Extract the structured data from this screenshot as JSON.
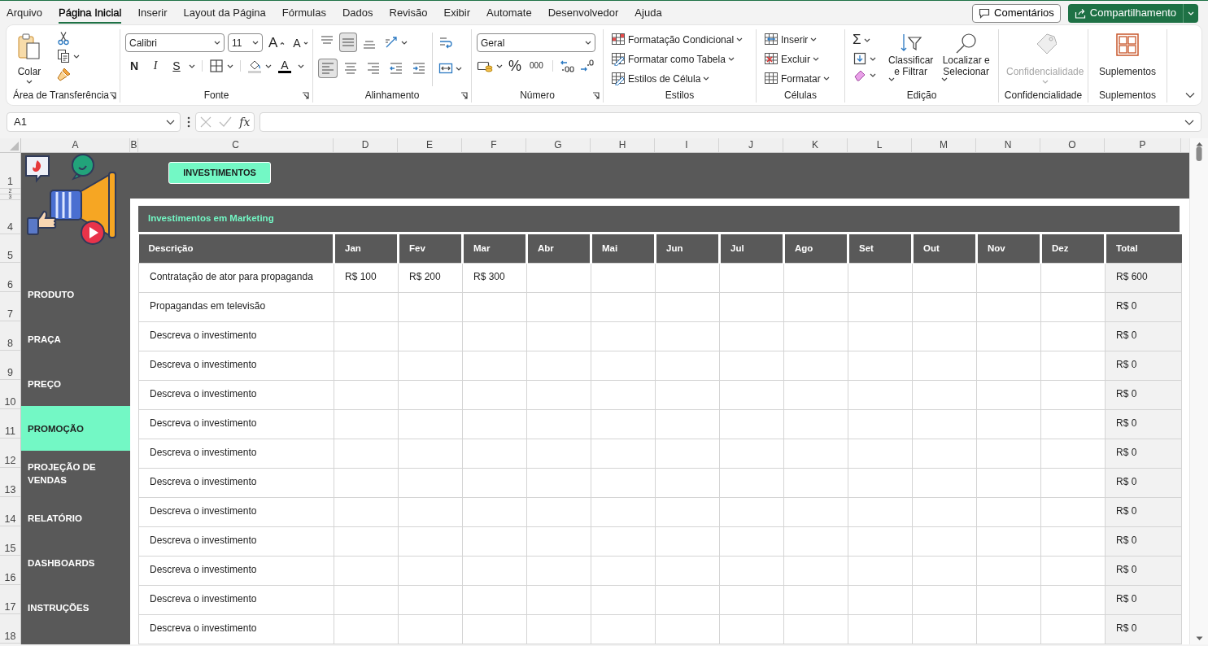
{
  "menu_tabs": [
    {
      "label": "Arquivo",
      "selected": false
    },
    {
      "label": "Página Inicial",
      "selected": true
    },
    {
      "label": "Inserir",
      "selected": false
    },
    {
      "label": "Layout da Página",
      "selected": false
    },
    {
      "label": "Fórmulas",
      "selected": false
    },
    {
      "label": "Dados",
      "selected": false
    },
    {
      "label": "Revisão",
      "selected": false
    },
    {
      "label": "Exibir",
      "selected": false
    },
    {
      "label": "Automate",
      "selected": false
    },
    {
      "label": "Desenvolvedor",
      "selected": false
    },
    {
      "label": "Ajuda",
      "selected": false
    }
  ],
  "comments_button": "Comentários",
  "share_button": "Compartilhamento",
  "ribbon": {
    "groups": [
      {
        "kind": "clipboard",
        "title": "Área de Transferência",
        "launcher": true,
        "paste_label": "Colar"
      },
      {
        "kind": "font",
        "title": "Fonte",
        "launcher": true,
        "font_name": "Calibri",
        "font_size": "11",
        "grow_label": "A",
        "shrink_label": "A",
        "bold_label": "N",
        "italic_label": "I",
        "underline_label": "S",
        "font_color_label": "A"
      },
      {
        "kind": "alignment",
        "title": "Alinhamento",
        "launcher": true,
        "buttons": [
          {
            "kind": "align-top",
            "selected": false
          },
          {
            "kind": "align-middle",
            "selected": true
          },
          {
            "kind": "align-bottom",
            "selected": false
          },
          {
            "kind": "orientation",
            "selected": false
          },
          {
            "kind": "align-left",
            "selected": true
          },
          {
            "kind": "align-center",
            "selected": false
          },
          {
            "kind": "align-right",
            "selected": false
          },
          {
            "kind": "decrease-indent",
            "selected": false
          },
          {
            "kind": "increase-indent",
            "selected": false
          },
          {
            "kind": "wrap-text",
            "selected": false
          },
          {
            "kind": "merge",
            "selected": false
          }
        ]
      },
      {
        "kind": "number",
        "title": "Número",
        "launcher": true,
        "format": "Geral",
        "percent_label": "%",
        "thousands_label": "000"
      },
      {
        "kind": "styles",
        "title": "Estilos",
        "items": [
          "Formatação Condicional",
          "Formatar como Tabela",
          "Estilos de Célula"
        ]
      },
      {
        "kind": "cells",
        "title": "Células",
        "items": [
          "Inserir",
          "Excluir",
          "Formatar"
        ]
      },
      {
        "kind": "editing",
        "title": "Edição",
        "sum_label": "Σ",
        "sort_label": "Classificar e Filtrar",
        "find_label": "Localizar e Selecionar"
      },
      {
        "kind": "sensitivity",
        "title": "Confidencialidade",
        "button_label": "Confidencialidade",
        "disabled": true
      },
      {
        "kind": "addins",
        "title": "Suplementos",
        "button_label": "Suplementos"
      }
    ]
  },
  "formula_bar": {
    "name_box": "A1",
    "function_label": "fx"
  },
  "sheet": {
    "column_headers": [
      "A",
      "B",
      "C",
      "D",
      "E",
      "F",
      "G",
      "H",
      "I",
      "J",
      "K",
      "L",
      "M",
      "N",
      "O",
      "P"
    ],
    "row_headers": [
      "1",
      "2",
      "3",
      "4",
      "5",
      "6",
      "7",
      "8",
      "9",
      "10",
      "11",
      "12",
      "13",
      "14",
      "15",
      "16",
      "17",
      "18"
    ],
    "header_button": "INVESTIMENTOS",
    "nav": [
      {
        "label": "PRODUTO",
        "selected": false
      },
      {
        "label": "PRAÇA",
        "selected": false
      },
      {
        "label": "PREÇO",
        "selected": false
      },
      {
        "label": "PROMOÇÃO",
        "selected": true
      },
      {
        "label": "PROJEÇÃO DE VENDAS",
        "selected": false
      },
      {
        "label": "RELATÓRIO",
        "selected": false
      },
      {
        "label": "DASHBOARDS",
        "selected": false
      },
      {
        "label": "INSTRUÇÕES",
        "selected": false
      }
    ],
    "table": {
      "title": "Investimentos em Marketing",
      "columns": [
        "Descrição",
        "Jan",
        "Fev",
        "Mar",
        "Abr",
        "Mai",
        "Jun",
        "Jul",
        "Ago",
        "Set",
        "Out",
        "Nov",
        "Dez",
        "Total"
      ],
      "rows": [
        {
          "description": "Contratação de ator para propaganda",
          "values": [
            "R$ 100",
            "R$ 200",
            "R$ 300"
          ],
          "total": "R$ 600"
        },
        {
          "description": "Propagandas em televisão",
          "total": "R$ 0"
        },
        {
          "description": "Descreva o investimento",
          "total": "R$ 0"
        },
        {
          "description": "Descreva o investimento",
          "total": "R$ 0"
        },
        {
          "description": "Descreva o investimento",
          "total": "R$ 0"
        },
        {
          "description": "Descreva o investimento",
          "total": "R$ 0"
        },
        {
          "description": "Descreva o investimento",
          "total": "R$ 0"
        },
        {
          "description": "Descreva o investimento",
          "total": "R$ 0"
        },
        {
          "description": "Descreva o investimento",
          "total": "R$ 0"
        },
        {
          "description": "Descreva o investimento",
          "total": "R$ 0"
        },
        {
          "description": "Descreva o investimento",
          "total": "R$ 0"
        },
        {
          "description": "Descreva o investimento",
          "total": "R$ 0"
        },
        {
          "description": "Descreva o investimento",
          "total": "R$ 0"
        }
      ]
    }
  }
}
